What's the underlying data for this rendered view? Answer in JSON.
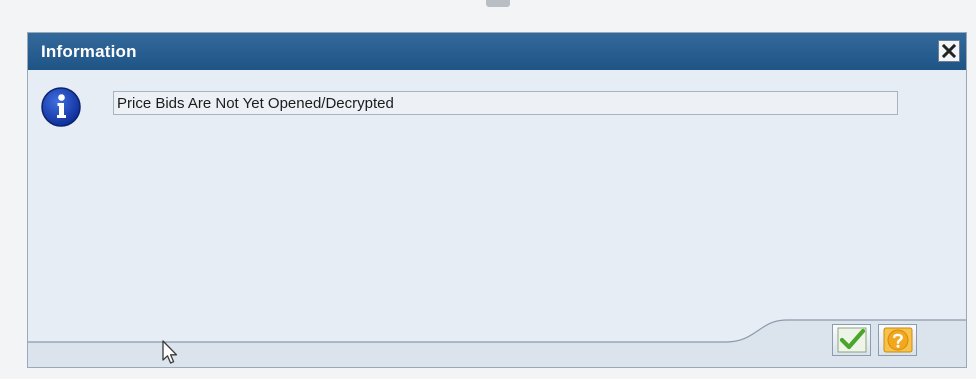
{
  "dialog": {
    "title": "Information",
    "message": "Price Bids Are Not Yet Opened/Decrypted",
    "icons": {
      "close": "close-icon",
      "info": "info-icon",
      "confirm": "checkmark-icon",
      "help": "help-icon",
      "cursor": "mouse-pointer-icon"
    }
  },
  "colors": {
    "title_bar": "#275c8f",
    "dialog_body": "#e7edf4",
    "info_icon": "#1c3fb8",
    "confirm_check": "#49a52b",
    "help_button": "#f2a81d"
  }
}
